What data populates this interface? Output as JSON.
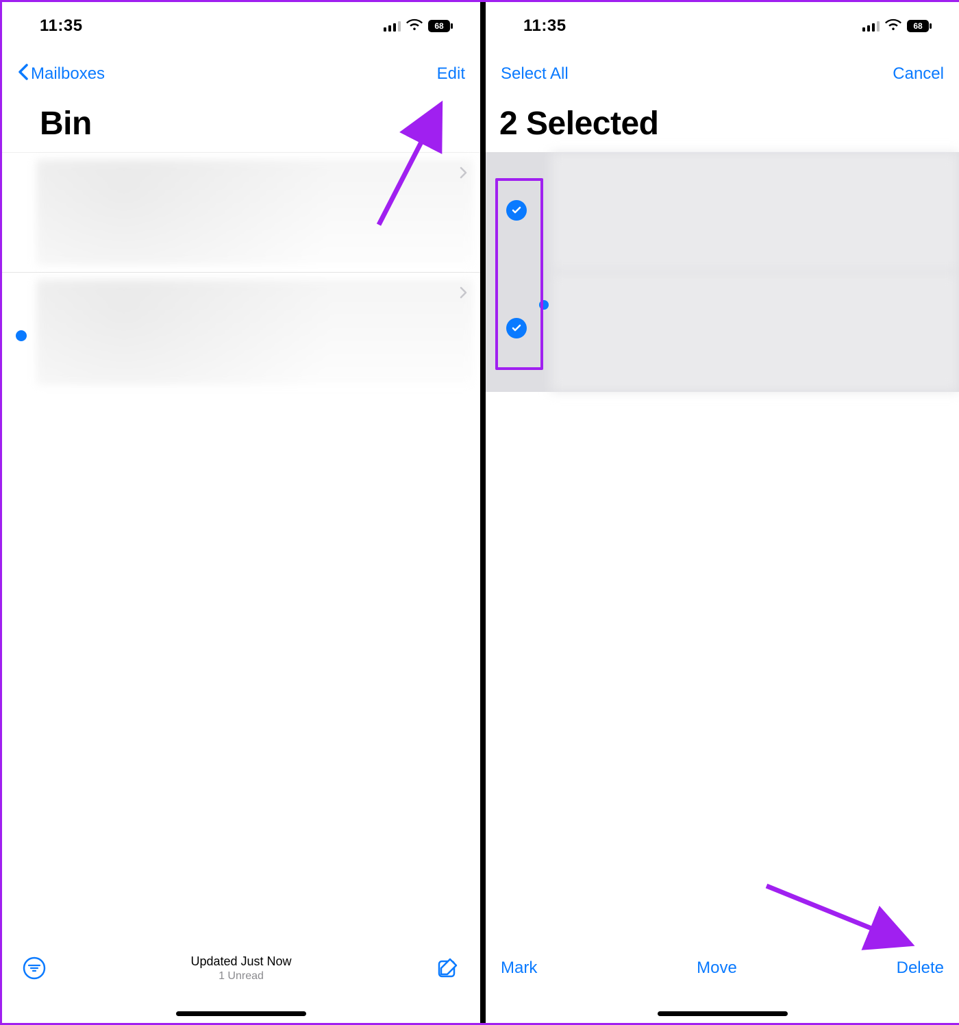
{
  "status": {
    "time": "11:35",
    "battery": "68"
  },
  "left": {
    "nav": {
      "back_label": "Mailboxes",
      "edit_label": "Edit"
    },
    "title": "Bin",
    "footer": {
      "status": "Updated Just Now",
      "unread": "1 Unread"
    }
  },
  "right": {
    "nav": {
      "select_all_label": "Select All",
      "cancel_label": "Cancel"
    },
    "title": "2 Selected",
    "toolbar": {
      "mark_label": "Mark",
      "move_label": "Move",
      "delete_label": "Delete"
    }
  },
  "annotation_color": "#a020f0"
}
